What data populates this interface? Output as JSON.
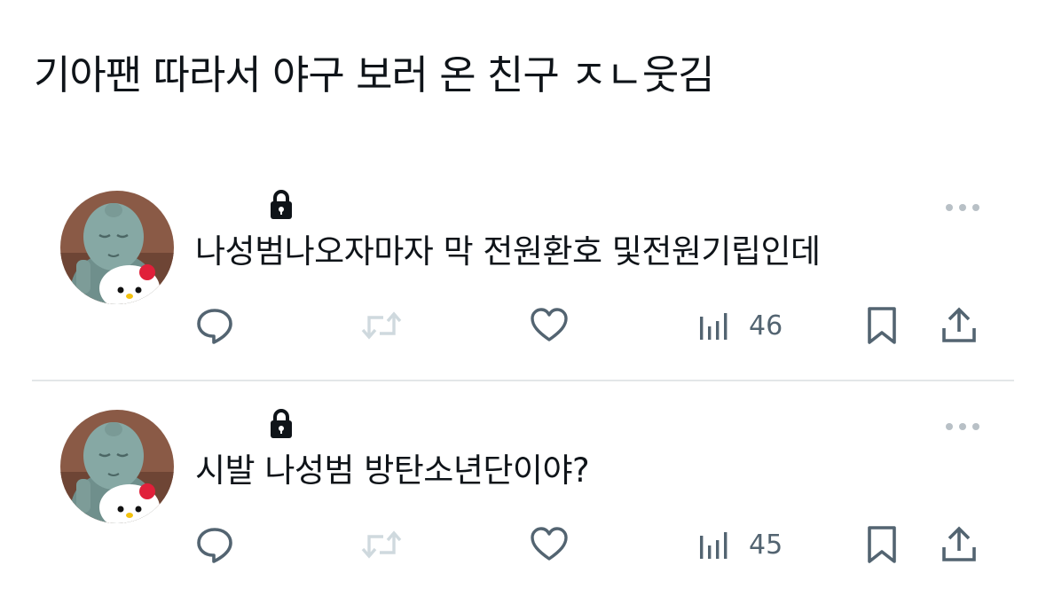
{
  "post": {
    "title": "기아팬 따라서 야구 보러 온 친구 ㅈㄴ웃김"
  },
  "tweets": [
    {
      "text": "나성범나오자마자 막 전원환호 및전원기립인데",
      "views": "46"
    },
    {
      "text": "시발 나성범 방탄소년단이야?",
      "views": "45"
    }
  ],
  "icons": {
    "avatar": "avatar-statue-with-hello-kitty",
    "lock": "lock-icon",
    "more": "more-options-icon",
    "reply": "reply-icon",
    "retweet": "retweet-icon",
    "like": "heart-icon",
    "views": "views-icon",
    "bookmark": "bookmark-icon",
    "share": "share-icon"
  },
  "colors": {
    "text": "#0f1419",
    "icon": "#536471",
    "muted_icon": "#cfd9de",
    "divider": "#e3e6e8"
  }
}
